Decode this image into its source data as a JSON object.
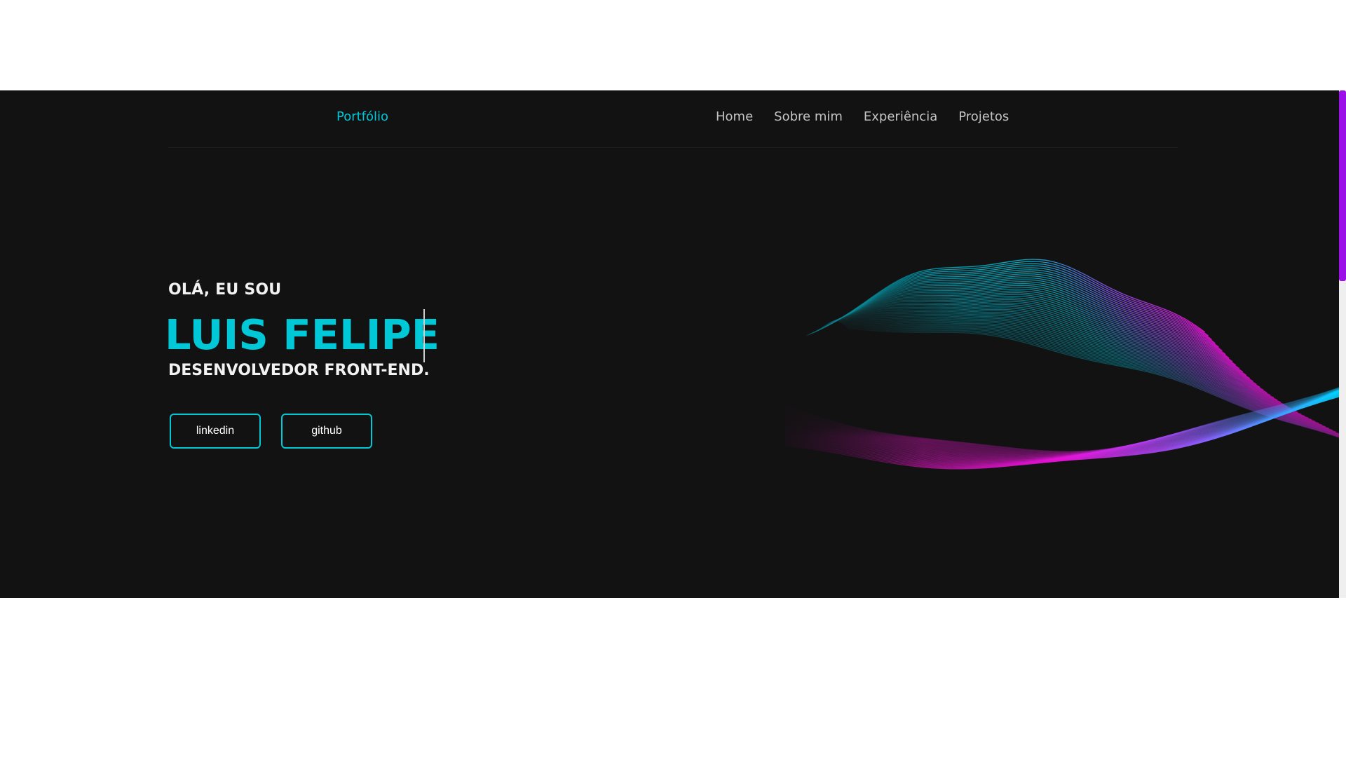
{
  "nav": {
    "brand": "Portfólio",
    "links": [
      "Home",
      "Sobre mim",
      "Experiência",
      "Projetos"
    ]
  },
  "hero": {
    "greeting": "OLÁ, EU SOU",
    "name": "LUIS FELIPE",
    "role": "DESENVOLVEDOR FRONT-END.",
    "buttons": {
      "linkedin": "linkedin",
      "github": "github"
    }
  },
  "colors": {
    "background": "#121212",
    "accent": "#00c8d7",
    "wave_cyan": "#00d2ff",
    "wave_magenta": "#ff10e6",
    "scrollbar": "#9b10e8"
  }
}
